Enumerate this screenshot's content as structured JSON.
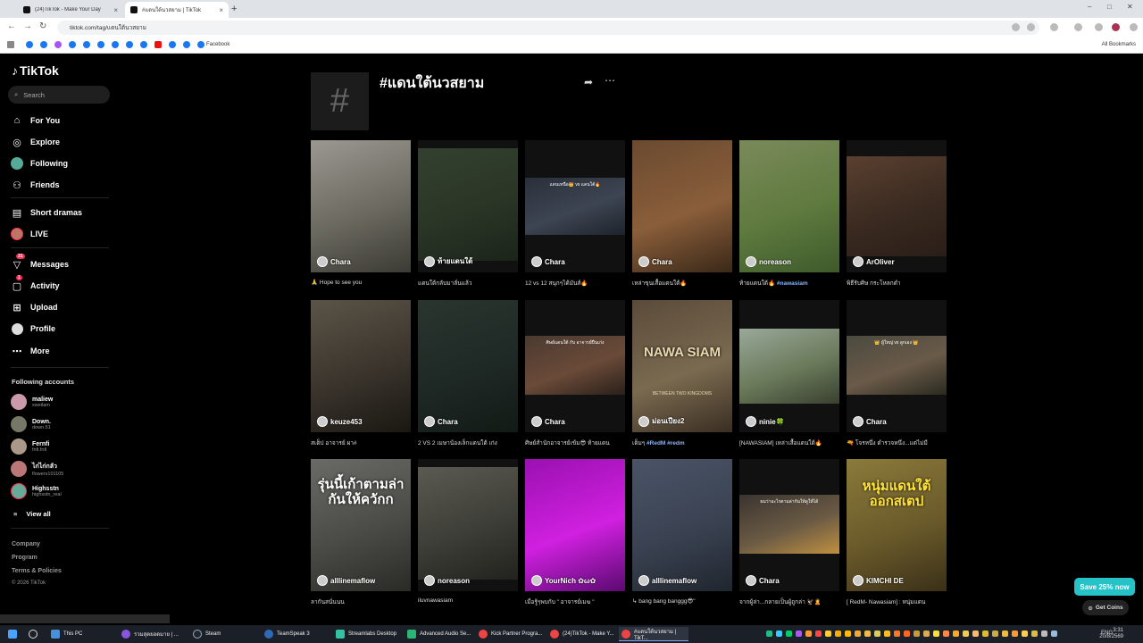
{
  "browser": {
    "tabs": [
      {
        "label": "(24)TikTok - Make Your Day"
      },
      {
        "label": "#แดนใต้นวสยาม | TikTok"
      }
    ],
    "url": "tiktok.com/tag/แดนใต้นวสยาม",
    "bookmark_label": "Facebook",
    "all_bookmarks": "All Bookmarks"
  },
  "sidebar": {
    "logo": "TikTok",
    "search_placeholder": "Search",
    "nav": [
      {
        "label": "For You",
        "icon": "home-icon"
      },
      {
        "label": "Explore",
        "icon": "compass-icon"
      },
      {
        "label": "Following",
        "icon": "following-avatar-icon"
      },
      {
        "label": "Friends",
        "icon": "friends-icon"
      },
      {
        "label": "Short dramas",
        "icon": "dramas-icon"
      },
      {
        "label": "LIVE",
        "icon": "live-icon"
      },
      {
        "label": "Messages",
        "icon": "messages-icon",
        "badge": "31"
      },
      {
        "label": "Activity",
        "icon": "activity-icon",
        "badge": "1"
      },
      {
        "label": "Upload",
        "icon": "upload-icon"
      },
      {
        "label": "Profile",
        "icon": "profile-icon"
      },
      {
        "label": "More",
        "icon": "more-icon"
      }
    ],
    "following_title": "Following accounts",
    "accounts": [
      {
        "name": "maliew",
        "handle": "xweilam"
      },
      {
        "name": "Down.",
        "handle": "down.51"
      },
      {
        "name": "Fernfi",
        "handle": "fnfi.fnfi"
      },
      {
        "name": "ไก่ไก่กลัว",
        "handle": "flowers101105"
      },
      {
        "name": "Highsstn",
        "handle": "highsstn_real"
      }
    ],
    "view_all": "View all",
    "footer": [
      "Company",
      "Program",
      "Terms & Policies"
    ],
    "copyright": "© 2026 TikTok"
  },
  "header": {
    "title": "#แดนใต้นวสยาม"
  },
  "videos": [
    {
      "owner": "Chara",
      "caption": "🙏 Hope to see you"
    },
    {
      "owner": "ท้ายแดนใต้",
      "caption": "แดนใต้กลับมาลั่นแล้ว"
    },
    {
      "owner": "Chara",
      "caption": "12 vs 12 สนุกๆได้มันส์🔥"
    },
    {
      "owner": "Chara",
      "caption": "เหล่าขุนเสื้อแดนใต้🔥"
    },
    {
      "owner": "noreason",
      "caption": "ท้ายแดนใต้🔥 ",
      "tag": "#nawasiam"
    },
    {
      "owner": "ArOliver",
      "caption": "พิธีรับศิษ กระโหลกดำ"
    },
    {
      "owner": "keuze453",
      "caption": "สเต็ป อาจารย์ ผา#"
    },
    {
      "owner": "Chara",
      "caption": "2 VS 2 เมษาน้องเล็กแดนใต้ เก่ง"
    },
    {
      "owner": "Chara",
      "caption": "ศิษย์สำนักอาจารย์เข้ม😎 ท้ายแดน"
    },
    {
      "owner": "ม่อนเปียง2",
      "caption": "เต็มๆ ",
      "tag": "#RedM #redm"
    },
    {
      "owner": "ninie🍀",
      "caption": "[NAWASIAM] เหล่าเสื้อแดนใต้🔥"
    },
    {
      "owner": "Chara",
      "caption": "🔫 โจรหนึ่ง ตำรวจหนึ่ง...แต่ไม่มี"
    },
    {
      "owner": "alllinemaflow",
      "caption": "ลากันสนั่นนน"
    },
    {
      "owner": "noreason",
      "caption": "iluvnawasiam"
    },
    {
      "owner": "YourNich ✿ω✿",
      "caption": "เมื่อรู้ๆพบกับ \" อาจารย์เมฆ \""
    },
    {
      "owner": "alllinemaflow",
      "caption": "↳ bang bang banggg😎\""
    },
    {
      "owner": "Chara",
      "caption": "จากผู้ล่า...กลายเป็นผู้ถูกล่า 🦅🙎"
    },
    {
      "owner": "KIMCHI DE",
      "caption": "[ RedM- Nawasiam] : หนุ่มแดน"
    }
  ],
  "overlay_texts": {
    "v3": "แดนเหนือ👑 vs แดนใต้🔥",
    "v9": "ศิษย์แดนใต้ กับ อาจารย์ปืนเก่ง",
    "v10_top": "NAWA SIAM",
    "v10_bottom": "BETWEEN TWO KINGDOMS",
    "v12": "👑 ผู้ใหญ่ vs ลูกเอง 👑",
    "v13": "รุ่นนี้เก้าตามล่ากันให้ควักก",
    "v17": "ผมว่าอะไรตามล่ากันให้ดูให้ได้",
    "v18": "หนุ่มแดนใต้ ออกสเตป"
  },
  "promo": {
    "save": "Save 25% now",
    "coins": "Get Coins"
  },
  "taskbar": {
    "items": [
      "This PC",
      "รวมสุดยอดมาย | ...",
      "Steam",
      "TeamSpeak 3",
      "Streamlabs Desktop",
      "Advanced Audio Se...",
      "Kick Partner Progra...",
      "(24)TikTok - Make Y...",
      "#แดนใต้นวสยาม | TikT..."
    ],
    "lang": "ENG",
    "time": "3:31",
    "date": "20/8/2569"
  }
}
